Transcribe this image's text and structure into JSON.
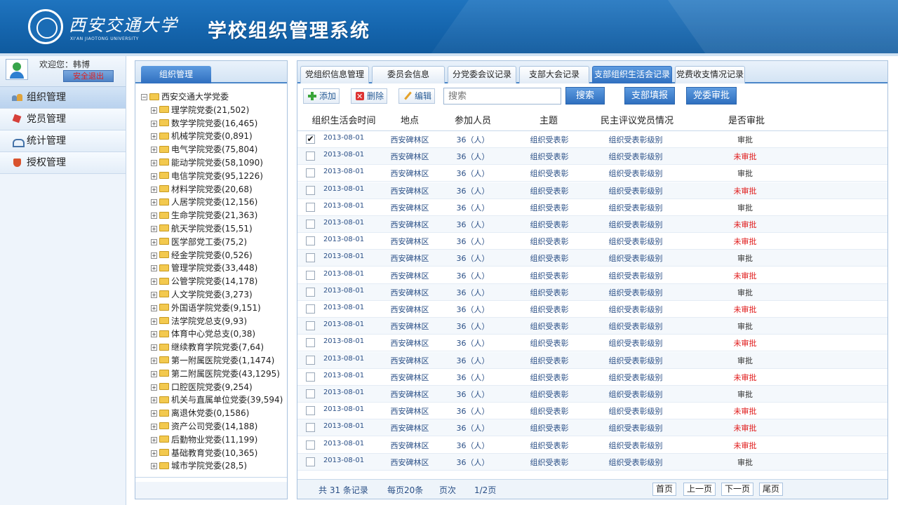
{
  "header": {
    "logo_cn": "西安交通大学",
    "logo_en": "XI'AN JIAOTONG UNIVERSITY",
    "system_title": "学校组织管理系统"
  },
  "user": {
    "welcome": "欢迎您：韩博",
    "logout_label": "安全退出"
  },
  "nav": {
    "items": [
      {
        "label": "组织管理",
        "icon": "org-icon",
        "active": true
      },
      {
        "label": "党员管理",
        "icon": "member-icon",
        "active": false
      },
      {
        "label": "统计管理",
        "icon": "stat-icon",
        "active": false
      },
      {
        "label": "授权管理",
        "icon": "auth-icon",
        "active": false
      }
    ]
  },
  "tree": {
    "tab_label": "组织管理",
    "root": "西安交通大学党委",
    "nodes": [
      "理学院党委(21,502)",
      "数学学院党委(16,465)",
      "机械学院党委(0,891)",
      "电气学院党委(75,804)",
      "能动学院党委(58,1090)",
      "电信学院党委(95,1226)",
      "材料学院党委(20,68)",
      "人居学院党委(12,156)",
      "生命学院党委(21,363)",
      "航天学院党委(15,51)",
      "医学部党工委(75,2)",
      "经金学院党委(0,526)",
      "管理学院党委(33,448)",
      "公管学院党委(14,178)",
      "人文学院党委(3,273)",
      "外国语学院党委(9,151)",
      "法学院党总支(9,93)",
      "体育中心党总支(0,38)",
      "继续教育学院党委(7,64)",
      "第一附属医院党委(1,1474)",
      "第二附属医院党委(43,1295)",
      "口腔医院党委(9,254)",
      "机关与直属单位党委(39,594)",
      "离退休党委(0,1586)",
      "资产公司党委(14,188)",
      "后勤物业党委(11,199)",
      "基础教育党委(10,365)",
      "城市学院党委(28,5)"
    ]
  },
  "tabs": [
    {
      "label": "党组织信息管理",
      "active": false
    },
    {
      "label": "委员会信息",
      "active": false
    },
    {
      "label": "分党委会议记录",
      "active": false
    },
    {
      "label": "支部大会记录",
      "active": false
    },
    {
      "label": "支部组织生活会记录",
      "active": true
    },
    {
      "label": "党费收支情况记录",
      "active": false
    }
  ],
  "toolbar": {
    "add_label": "添加",
    "delete_label": "删除",
    "edit_label": "编辑",
    "search_placeholder": "搜索",
    "search_button": "搜索",
    "branch_fill_button": "支部填报",
    "committee_approve_button": "党委审批"
  },
  "table": {
    "columns": [
      "组织生活会时间",
      "地点",
      "参加人员",
      "主题",
      "民主评议党员情况",
      "是否审批"
    ],
    "rows": [
      {
        "checked": true,
        "date": "2013-08-01",
        "place": "西安碑林区",
        "people": "36（人）",
        "topic": "组织受表彰",
        "review": "组织受表彰级别",
        "approval": "审批"
      },
      {
        "checked": false,
        "date": "2013-08-01",
        "place": "西安碑林区",
        "people": "36（人）",
        "topic": "组织受表彰",
        "review": "组织受表彰级别",
        "approval": "未审批"
      },
      {
        "checked": false,
        "date": "2013-08-01",
        "place": "西安碑林区",
        "people": "36（人）",
        "topic": "组织受表彰",
        "review": "组织受表彰级别",
        "approval": "审批"
      },
      {
        "checked": false,
        "date": "2013-08-01",
        "place": "西安碑林区",
        "people": "36（人）",
        "topic": "组织受表彰",
        "review": "组织受表彰级别",
        "approval": "未审批"
      },
      {
        "checked": false,
        "date": "2013-08-01",
        "place": "西安碑林区",
        "people": "36（人）",
        "topic": "组织受表彰",
        "review": "组织受表彰级别",
        "approval": "审批"
      },
      {
        "checked": false,
        "date": "2013-08-01",
        "place": "西安碑林区",
        "people": "36（人）",
        "topic": "组织受表彰",
        "review": "组织受表彰级别",
        "approval": "未审批"
      },
      {
        "checked": false,
        "date": "2013-08-01",
        "place": "西安碑林区",
        "people": "36（人）",
        "topic": "组织受表彰",
        "review": "组织受表彰级别",
        "approval": "未审批"
      },
      {
        "checked": false,
        "date": "2013-08-01",
        "place": "西安碑林区",
        "people": "36（人）",
        "topic": "组织受表彰",
        "review": "组织受表彰级别",
        "approval": "审批"
      },
      {
        "checked": false,
        "date": "2013-08-01",
        "place": "西安碑林区",
        "people": "36（人）",
        "topic": "组织受表彰",
        "review": "组织受表彰级别",
        "approval": "未审批"
      },
      {
        "checked": false,
        "date": "2013-08-01",
        "place": "西安碑林区",
        "people": "36（人）",
        "topic": "组织受表彰",
        "review": "组织受表彰级别",
        "approval": "审批"
      },
      {
        "checked": false,
        "date": "2013-08-01",
        "place": "西安碑林区",
        "people": "36（人）",
        "topic": "组织受表彰",
        "review": "组织受表彰级别",
        "approval": "未审批"
      },
      {
        "checked": false,
        "date": "2013-08-01",
        "place": "西安碑林区",
        "people": "36（人）",
        "topic": "组织受表彰",
        "review": "组织受表彰级别",
        "approval": "审批"
      },
      {
        "checked": false,
        "date": "2013-08-01",
        "place": "西安碑林区",
        "people": "36（人）",
        "topic": "组织受表彰",
        "review": "组织受表彰级别",
        "approval": "未审批"
      },
      {
        "checked": false,
        "date": "2013-08-01",
        "place": "西安碑林区",
        "people": "36（人）",
        "topic": "组织受表彰",
        "review": "组织受表彰级别",
        "approval": "审批"
      },
      {
        "checked": false,
        "date": "2013-08-01",
        "place": "西安碑林区",
        "people": "36（人）",
        "topic": "组织受表彰",
        "review": "组织受表彰级别",
        "approval": "未审批"
      },
      {
        "checked": false,
        "date": "2013-08-01",
        "place": "西安碑林区",
        "people": "36（人）",
        "topic": "组织受表彰",
        "review": "组织受表彰级别",
        "approval": "审批"
      },
      {
        "checked": false,
        "date": "2013-08-01",
        "place": "西安碑林区",
        "people": "36（人）",
        "topic": "组织受表彰",
        "review": "组织受表彰级别",
        "approval": "未审批"
      },
      {
        "checked": false,
        "date": "2013-08-01",
        "place": "西安碑林区",
        "people": "36（人）",
        "topic": "组织受表彰",
        "review": "组织受表彰级别",
        "approval": "未审批"
      },
      {
        "checked": false,
        "date": "2013-08-01",
        "place": "西安碑林区",
        "people": "36（人）",
        "topic": "组织受表彰",
        "review": "组织受表彰级别",
        "approval": "未审批"
      },
      {
        "checked": false,
        "date": "2013-08-01",
        "place": "西安碑林区",
        "people": "36（人）",
        "topic": "组织受表彰",
        "review": "组织受表彰级别",
        "approval": "审批"
      }
    ]
  },
  "pager": {
    "total_text": "共 31 条记录",
    "per_page_text": "每页20条",
    "page_label": "页次",
    "page_value": "1/2页",
    "first": "首页",
    "prev": "上一页",
    "next": "下一页",
    "last": "尾页"
  },
  "colors": {
    "header_blue": "#1565ad",
    "accent_blue": "#2f6fbf",
    "unapproved_red": "#e01818"
  }
}
